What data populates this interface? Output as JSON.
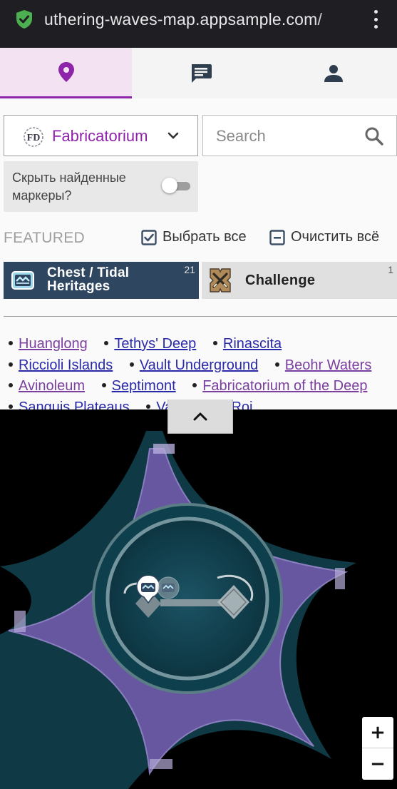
{
  "browser": {
    "url": "uthering-waves-map.appsample.com/",
    "shield_icon": "shield-check-icon",
    "menu_icon": "kebab-menu-icon"
  },
  "tabs": [
    {
      "icon": "map-pin-icon",
      "active": true
    },
    {
      "icon": "comment-icon",
      "active": false
    },
    {
      "icon": "user-icon",
      "active": false
    }
  ],
  "colors": {
    "accent": "#8e24aa",
    "tab_active_bg": "#f3e3f2",
    "chest_bg": "#2f4660",
    "challenge_bg": "#e0e0e0",
    "map_purple": "#6e5aa8",
    "map_teal": "#0f3a45"
  },
  "region_select": {
    "logo_text": "FD",
    "label": "Fabricatorium"
  },
  "search": {
    "placeholder": "Search"
  },
  "hide_found": {
    "label": "Скрыть найденные маркеры?",
    "enabled": false
  },
  "featured": {
    "heading": "FEATURED",
    "select_all": "Выбрать все",
    "clear_all": "Очистить всё"
  },
  "categories": [
    {
      "label": "Chest / Tidal Heritages",
      "count": "21",
      "icon": "chest-icon",
      "selected": true
    },
    {
      "label": "Challenge",
      "count": "1",
      "icon": "crossed-swords-icon",
      "selected": false
    }
  ],
  "region_links": [
    {
      "label": "Huanglong",
      "visited": true
    },
    {
      "label": "Tethys' Deep",
      "visited": false
    },
    {
      "label": "Rinascita",
      "visited": false
    },
    {
      "label": "Riccioli Islands",
      "visited": false
    },
    {
      "label": "Vault Underground",
      "visited": false
    },
    {
      "label": "Beohr Waters",
      "visited": true
    },
    {
      "label": "Avinoleum",
      "visited": true
    },
    {
      "label": "Septimont",
      "visited": false
    },
    {
      "label": "Fabricatorium of the Deep",
      "visited": true
    },
    {
      "label": "Sanguis Plateaus",
      "visited": false
    },
    {
      "label": "Vault of the Roi",
      "visited": false
    }
  ],
  "map": {
    "collapse_icon": "chevron-up-icon",
    "zoom_in": "+",
    "zoom_out": "−"
  }
}
